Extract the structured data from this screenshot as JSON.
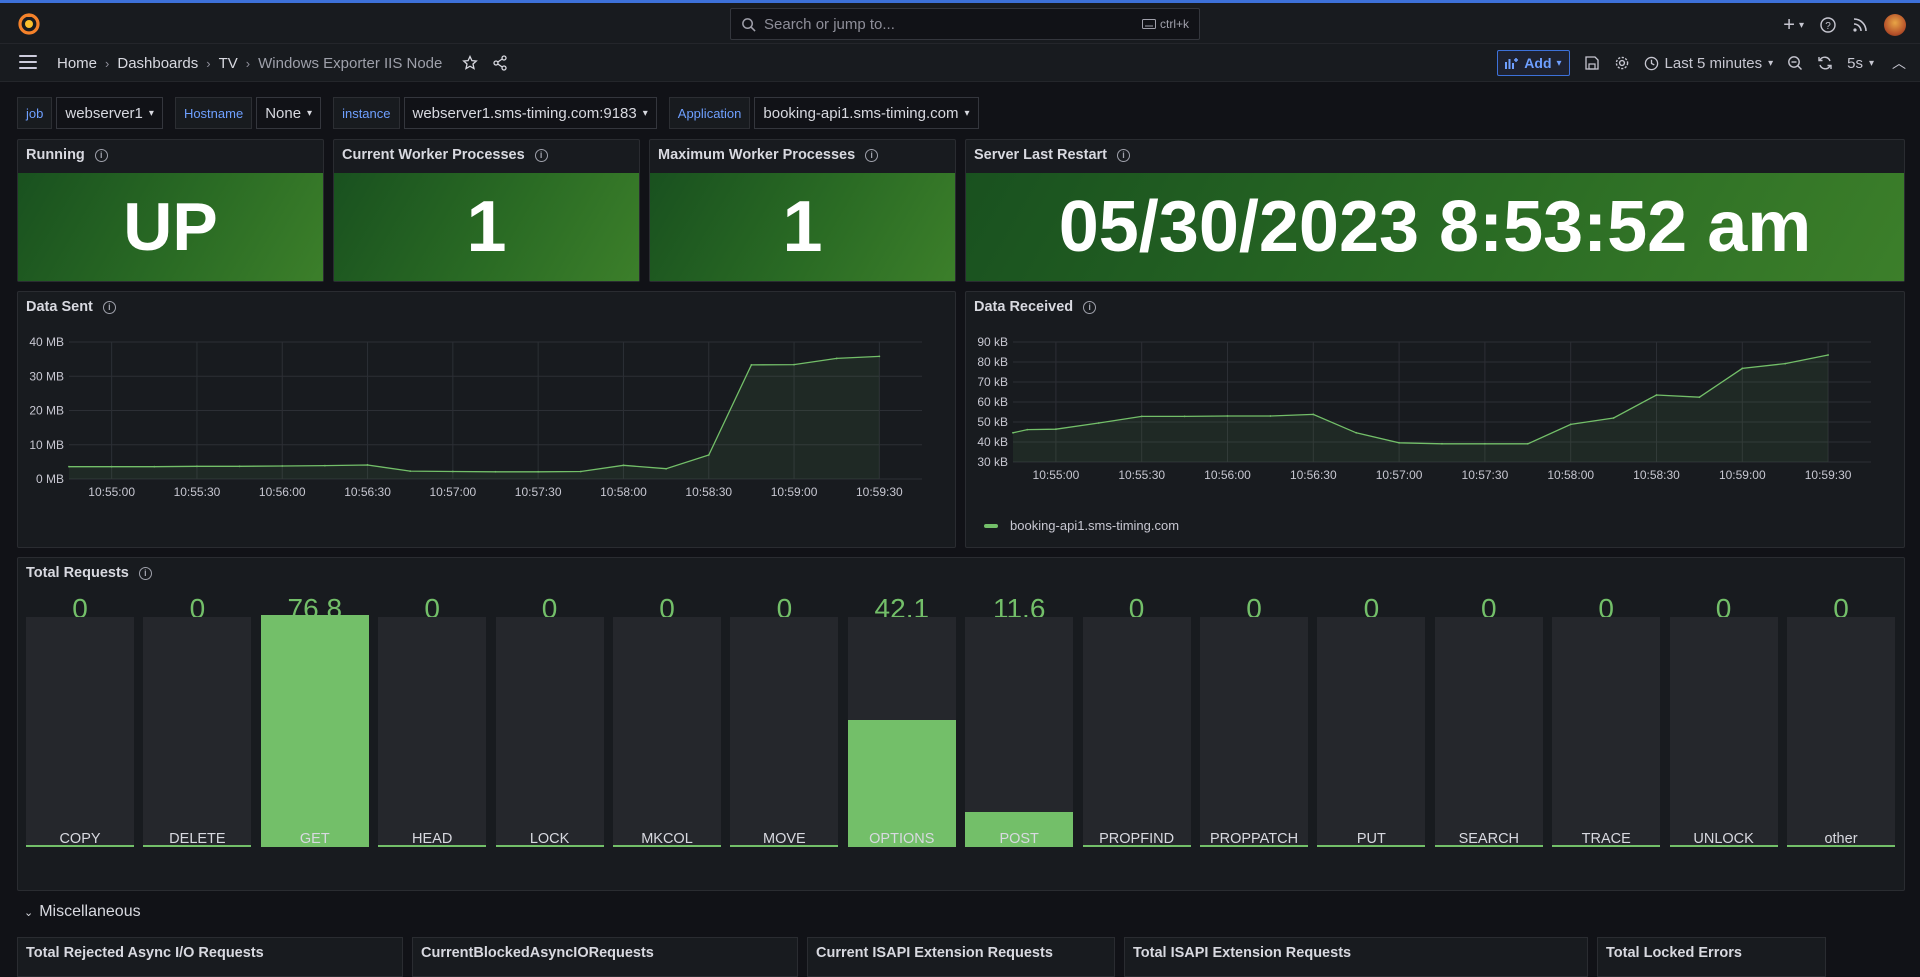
{
  "topbar": {
    "search_placeholder": "Search or jump to...",
    "search_shortcut": "ctrl+k"
  },
  "breadcrumb": [
    "Home",
    "Dashboards",
    "TV",
    "Windows Exporter IIS Node"
  ],
  "toolbar": {
    "add_label": "Add",
    "time_range": "Last 5 minutes",
    "refresh_interval": "5s"
  },
  "variables": [
    {
      "label": "job",
      "value": "webserver1"
    },
    {
      "label": "Hostname",
      "value": "None"
    },
    {
      "label": "instance",
      "value": "webserver1.sms-timing.com:9183"
    },
    {
      "label": "Application",
      "value": "booking-api1.sms-timing.com"
    }
  ],
  "stats": [
    {
      "title": "Running",
      "value": "UP"
    },
    {
      "title": "Current Worker Processes",
      "value": "1"
    },
    {
      "title": "Maximum Worker Processes",
      "value": "1"
    },
    {
      "title": "Server Last Restart",
      "value": "05/30/2023 8:53:52 am"
    }
  ],
  "colors": {
    "accent": "#3d71d9",
    "green": "#73bf69",
    "stat_bg": "#2a6b24",
    "panel_bg": "#181b1f"
  },
  "chart_data": [
    {
      "type": "area",
      "title": "Data Sent",
      "y_ticks": [
        "0 MB",
        "10 MB",
        "20 MB",
        "30 MB",
        "40 MB"
      ],
      "ylim": [
        0,
        40
      ],
      "x_ticks": [
        "10:55:00",
        "10:55:30",
        "10:56:00",
        "10:56:30",
        "10:57:00",
        "10:57:30",
        "10:58:00",
        "10:58:30",
        "10:59:00",
        "10:59:30"
      ],
      "series": [
        {
          "x": [
            "10:54:45",
            "10:55:00",
            "10:55:15",
            "10:55:30",
            "10:55:45",
            "10:56:00",
            "10:56:15",
            "10:56:30",
            "10:56:45",
            "10:57:00",
            "10:57:15",
            "10:57:30",
            "10:57:45",
            "10:58:00",
            "10:58:15",
            "10:58:30",
            "10:58:45",
            "10:59:00",
            "10:59:15",
            "10:59:30"
          ],
          "values": [
            3.6,
            3.6,
            3.6,
            3.7,
            3.7,
            3.8,
            3.9,
            4.1,
            2.3,
            2.2,
            2.1,
            2.1,
            2.2,
            4.0,
            3.0,
            7.0,
            33.3,
            33.4,
            35.2,
            35.8
          ]
        }
      ]
    },
    {
      "type": "area",
      "title": "Data Received",
      "y_ticks": [
        "30 kB",
        "40 kB",
        "50 kB",
        "60 kB",
        "70 kB",
        "80 kB",
        "90 kB"
      ],
      "ylim": [
        30,
        90
      ],
      "x_ticks": [
        "10:55:00",
        "10:55:30",
        "10:56:00",
        "10:56:30",
        "10:57:00",
        "10:57:30",
        "10:58:00",
        "10:58:30",
        "10:59:00",
        "10:59:30"
      ],
      "series": [
        {
          "name": "booking-api1.sms-timing.com",
          "x": [
            "10:54:45",
            "10:54:50",
            "10:55:00",
            "10:55:15",
            "10:55:30",
            "10:55:45",
            "10:56:00",
            "10:56:15",
            "10:56:30",
            "10:56:45",
            "10:57:00",
            "10:57:15",
            "10:57:30",
            "10:57:45",
            "10:58:00",
            "10:58:15",
            "10:58:30",
            "10:58:45",
            "10:59:00",
            "10:59:15",
            "10:59:30"
          ],
          "values": [
            44.6,
            46.2,
            46.4,
            49.5,
            52.8,
            52.8,
            53.0,
            53.0,
            53.8,
            44.6,
            39.6,
            39.1,
            39.1,
            39.1,
            48.8,
            52.0,
            63.5,
            62.4,
            76.8,
            79.2,
            83.5
          ]
        }
      ]
    },
    {
      "type": "bar",
      "title": "Total Requests",
      "categories": [
        "COPY",
        "DELETE",
        "GET",
        "HEAD",
        "LOCK",
        "MKCOL",
        "MOVE",
        "OPTIONS",
        "POST",
        "PROPFIND",
        "PROPPATCH",
        "PUT",
        "SEARCH",
        "TRACE",
        "UNLOCK",
        "other"
      ],
      "values": [
        0,
        0,
        76.8,
        0,
        0,
        0,
        0,
        42.1,
        11.6,
        0,
        0,
        0,
        0,
        0,
        0,
        0
      ],
      "labels": [
        "0",
        "0",
        "76.8",
        "0",
        "0",
        "0",
        "0",
        "42.1",
        "11.6",
        "0",
        "0",
        "0",
        "0",
        "0",
        "0",
        "0"
      ],
      "ylim": [
        0,
        76.8
      ]
    }
  ],
  "section": {
    "title": "Miscellaneous"
  },
  "bottom_panels": [
    "Total Rejected Async I/O Requests",
    "CurrentBlockedAsyncIORequests",
    "Current ISAPI Extension Requests",
    "Total ISAPI Extension Requests",
    "Total Locked Errors"
  ]
}
